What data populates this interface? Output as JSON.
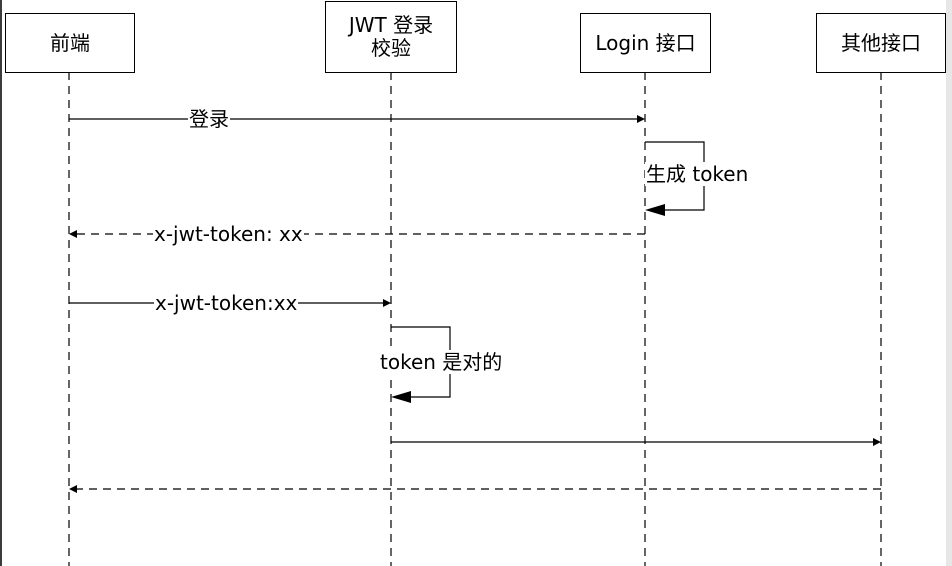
{
  "lanes": [
    {
      "id": "frontend",
      "label": "前端"
    },
    {
      "id": "jwt",
      "label": "JWT 登录\n校验"
    },
    {
      "id": "login",
      "label": "Login 接口"
    },
    {
      "id": "other",
      "label": "其他接口"
    }
  ],
  "messages": [
    {
      "id": "login-request",
      "from": "frontend",
      "to": "login",
      "label": "登录",
      "style": "solid"
    },
    {
      "id": "generate-token",
      "from": "login",
      "to": "login",
      "label": "生成 token",
      "style": "self"
    },
    {
      "id": "token-response",
      "from": "login",
      "to": "frontend",
      "label": "x-jwt-token: xx",
      "style": "dashed"
    },
    {
      "id": "token-request",
      "from": "frontend",
      "to": "jwt",
      "label": "x-jwt-token:xx",
      "style": "solid"
    },
    {
      "id": "token-valid",
      "from": "jwt",
      "to": "jwt",
      "label": "token 是对的",
      "style": "self"
    },
    {
      "id": "forward-request",
      "from": "jwt",
      "to": "other",
      "label": "",
      "style": "solid"
    },
    {
      "id": "other-response",
      "from": "other",
      "to": "frontend",
      "label": "",
      "style": "dashed"
    }
  ]
}
